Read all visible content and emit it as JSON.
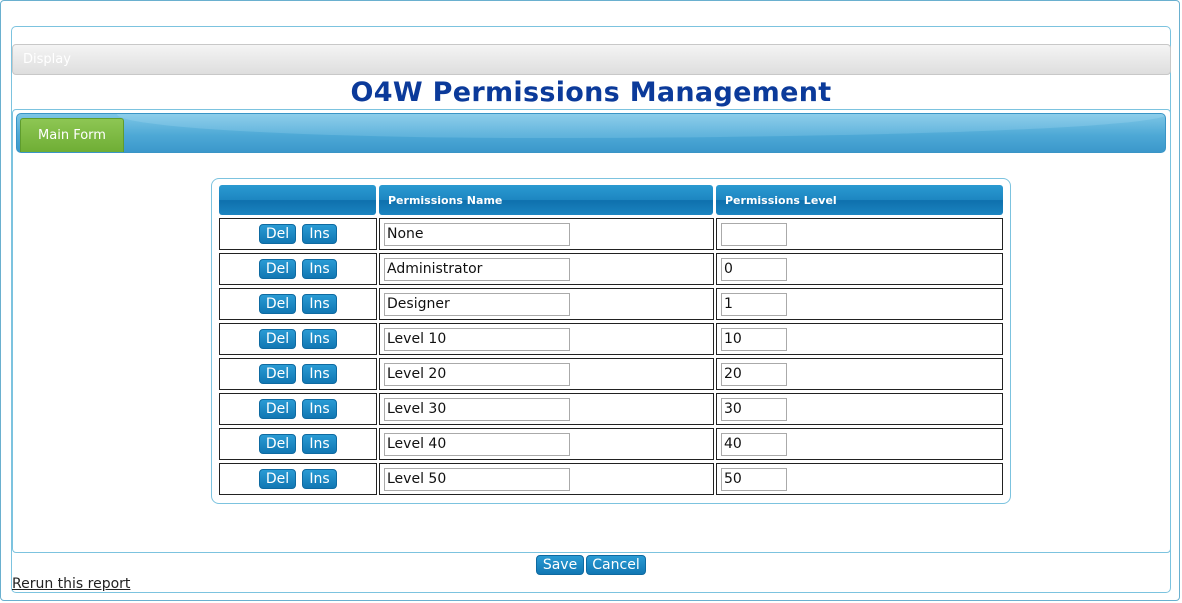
{
  "display_bar": {
    "label": "Display"
  },
  "page": {
    "title": "O4W Permissions Management"
  },
  "tabs": [
    {
      "label": "Main Form"
    }
  ],
  "grid": {
    "columns": [
      "",
      "Permissions Name",
      "Permissions Level"
    ],
    "row_buttons": {
      "delete": "Del",
      "insert": "Ins"
    },
    "rows": [
      {
        "name": "None",
        "level": ""
      },
      {
        "name": "Administrator",
        "level": "0"
      },
      {
        "name": "Designer",
        "level": "1"
      },
      {
        "name": "Level 10",
        "level": "10"
      },
      {
        "name": "Level 20",
        "level": "20"
      },
      {
        "name": "Level 30",
        "level": "30"
      },
      {
        "name": "Level 40",
        "level": "40"
      },
      {
        "name": "Level 50",
        "level": "50"
      }
    ]
  },
  "actions": {
    "save": "Save",
    "cancel": "Cancel"
  },
  "footer": {
    "rerun_link": "Rerun this report"
  },
  "colors": {
    "title": "#0b3a9a",
    "accent_blue": "#1d86c1",
    "tab_green": "#7cbb44",
    "frame_border": "#7cc3df"
  }
}
